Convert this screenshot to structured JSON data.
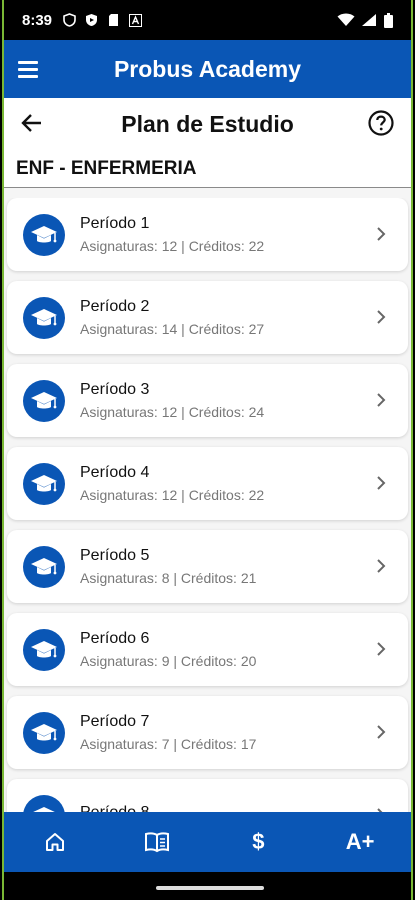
{
  "status": {
    "time": "8:39"
  },
  "appbar": {
    "title": "Probus Academy"
  },
  "page": {
    "title": "Plan de Estudio",
    "program": "ENF - ENFERMERIA"
  },
  "periods": [
    {
      "title": "Período 1",
      "subtitle": "Asignaturas: 12 | Créditos: 22"
    },
    {
      "title": "Período 2",
      "subtitle": "Asignaturas: 14 | Créditos: 27"
    },
    {
      "title": "Período 3",
      "subtitle": "Asignaturas: 12 | Créditos: 24"
    },
    {
      "title": "Período 4",
      "subtitle": "Asignaturas: 12 | Créditos: 22"
    },
    {
      "title": "Período 5",
      "subtitle": "Asignaturas: 8 | Créditos: 21"
    },
    {
      "title": "Período 6",
      "subtitle": "Asignaturas: 9 | Créditos: 20"
    },
    {
      "title": "Período 7",
      "subtitle": "Asignaturas: 7 | Créditos: 17"
    },
    {
      "title": "Período 8",
      "subtitle": ""
    }
  ],
  "bottom_nav": {
    "items": [
      {
        "icon": "home-icon"
      },
      {
        "icon": "book-icon"
      },
      {
        "icon": "dollar-icon",
        "label": "$"
      },
      {
        "icon": "font-size-icon",
        "label": "A+"
      }
    ]
  },
  "colors": {
    "primary": "#0a56b5",
    "frame_accent": "#7ab835"
  }
}
